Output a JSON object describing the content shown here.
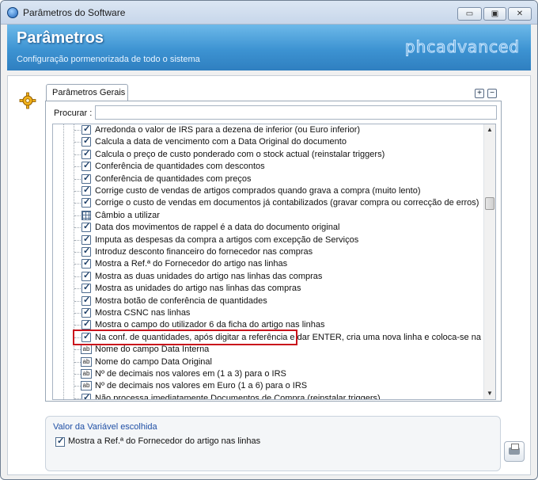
{
  "window": {
    "title": "Parâmetros do Software",
    "minimize": "▭",
    "restore": "▣",
    "close": "✕"
  },
  "header": {
    "title": "Parâmetros",
    "subtitle": "Configuração pormenorizada de todo o sistema",
    "brand": "phcadvanced"
  },
  "tab": {
    "label": "Parâmetros Gerais"
  },
  "buttons": {
    "expand": "+",
    "collapse": "−"
  },
  "search": {
    "label": "Procurar :",
    "value": ""
  },
  "list": {
    "items": [
      {
        "icon": "checkbox-icon",
        "label": "Arredonda o valor de IRS para a dezena de  inferior (ou Euro inferior)"
      },
      {
        "icon": "checkbox-icon",
        "label": "Calcula a data de vencimento com a Data Original do documento"
      },
      {
        "icon": "checkbox-icon",
        "label": "Calcula o preço de custo ponderado com o stock actual (reinstalar triggers)"
      },
      {
        "icon": "checkbox-icon",
        "label": "Conferência de quantidades com descontos"
      },
      {
        "icon": "checkbox-icon",
        "label": "Conferência de quantidades com preços"
      },
      {
        "icon": "checkbox-icon",
        "label": "Corrige custo de vendas de artigos comprados quando grava a compra (muito lento)"
      },
      {
        "icon": "checkbox-icon",
        "label": "Corrige o custo de vendas em documentos já contabilizados (gravar compra ou correcção de erros)"
      },
      {
        "icon": "grid-icon",
        "label": "Câmbio a utilizar"
      },
      {
        "icon": "checkbox-icon",
        "label": "Data dos movimentos de rappel é a data do documento original"
      },
      {
        "icon": "checkbox-icon",
        "label": "Imputa as despesas da compra a artigos com excepção de Serviços"
      },
      {
        "icon": "checkbox-icon",
        "label": "Introduz desconto financeiro do fornecedor nas compras"
      },
      {
        "icon": "checkbox-icon",
        "label": "Mostra a Ref.ª do Fornecedor do artigo nas linhas"
      },
      {
        "icon": "checkbox-icon",
        "label": "Mostra as duas unidades do artigo nas linhas das compras"
      },
      {
        "icon": "checkbox-icon",
        "label": "Mostra as unidades do artigo nas linhas das compras"
      },
      {
        "icon": "checkbox-icon",
        "label": "Mostra botão de conferência de quantidades"
      },
      {
        "icon": "checkbox-icon",
        "label": "Mostra CSNC nas linhas"
      },
      {
        "icon": "checkbox-icon",
        "label": "Mostra o campo do utilizador 6 da ficha do artigo nas linhas"
      },
      {
        "icon": "checkbox-icon",
        "label": "Na conf. de quantidades, após digitar a referência e dar ENTER, cria uma nova linha e coloca-se na ref."
      },
      {
        "icon": "text-field-icon",
        "label": "Nome do campo Data Interna"
      },
      {
        "icon": "text-field-icon",
        "label": "Nome do campo Data Original"
      },
      {
        "icon": "text-field-icon",
        "label": "Nº de decimais nos valores em  (1 a 3) para o IRS"
      },
      {
        "icon": "text-field-icon",
        "label": "Nº de decimais nos valores em Euro (1 a 6) para o IRS"
      },
      {
        "icon": "checkbox-icon",
        "label": "Não processa imediatamente Documentos de Compra (reinstalar triggers)"
      }
    ]
  },
  "selected": {
    "panel_title": "Valor da Variável escolhida",
    "label": "Mostra a Ref.ª do Fornecedor do artigo nas linhas"
  },
  "print_icon": "printer-icon"
}
